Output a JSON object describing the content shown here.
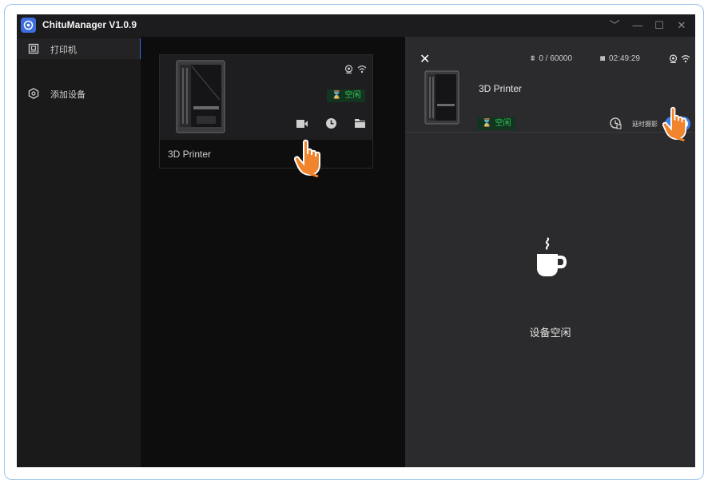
{
  "app": {
    "title": "ChituManager V1.0.9"
  },
  "window_controls": {
    "collapse": "﹀",
    "minimize": "—",
    "maximize": "☐",
    "close": "✕"
  },
  "sidebar": {
    "items": [
      {
        "label": "打印机",
        "icon": "printer-icon",
        "active": true
      },
      {
        "label": "添加设备",
        "icon": "add-device-icon",
        "active": false
      }
    ]
  },
  "card": {
    "name": "3D Printer",
    "status": "空闲",
    "icons": [
      "camera-icon",
      "wifi-icon",
      "timelapse-video-icon",
      "history-icon",
      "folder-icon"
    ]
  },
  "detail": {
    "layers": "0 / 60000",
    "time": "02:49:29",
    "printer_name": "3D Printer",
    "status": "空闲",
    "timelapse_label": "延时摄影",
    "timelapse_enabled": true,
    "idle_text": "设备空闲"
  },
  "colors": {
    "accent": "#3d7fe8",
    "status_green": "#34c759",
    "cursor_orange": "#f0852d"
  }
}
